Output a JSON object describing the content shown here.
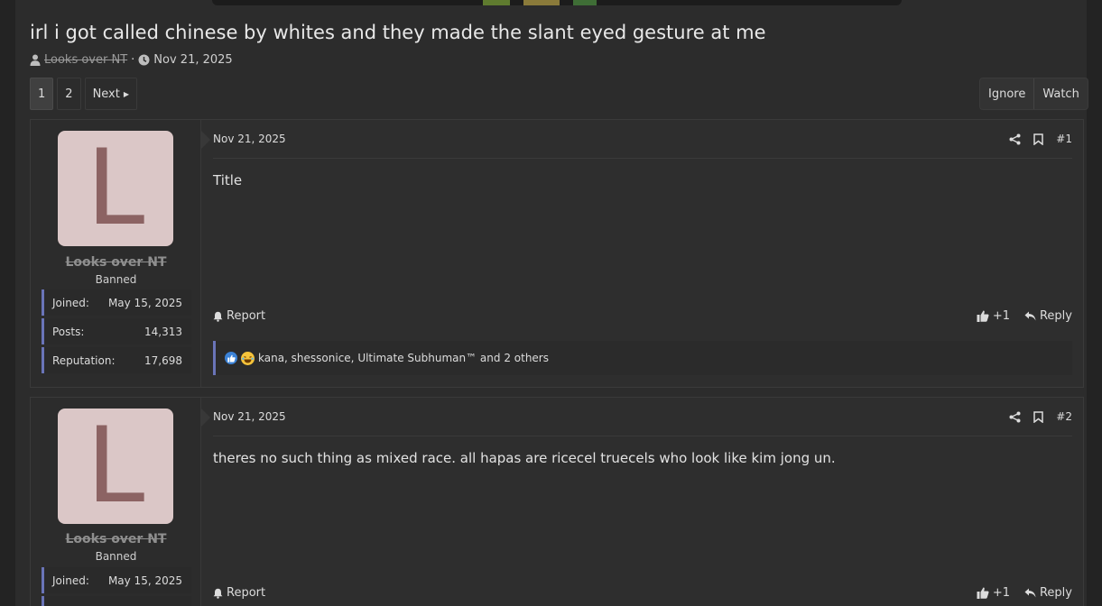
{
  "thread": {
    "title": "irl i got called chinese by whites and they made the slant eyed gesture at me",
    "author": "Looks over NT",
    "separator": "·",
    "date": "Nov 21, 2025"
  },
  "pager": {
    "pages": [
      "1",
      "2"
    ],
    "current": "1",
    "next_label": "Next"
  },
  "actions": {
    "ignore": "Ignore",
    "watch": "Watch"
  },
  "posts": [
    {
      "avatar_letter": "L",
      "username": "Looks over NT",
      "user_title": "Banned",
      "stats": [
        {
          "label": "Joined:",
          "value": "May 15, 2025"
        },
        {
          "label": "Posts:",
          "value": "14,313"
        },
        {
          "label": "Reputation:",
          "value": "17,698"
        }
      ],
      "date": "Nov 21, 2025",
      "number": "#1",
      "body": "Title",
      "report": "Report",
      "plus": "+1",
      "reply": "Reply",
      "reactions": "kana, shessonice, Ultimate Subhuman™ and 2 others"
    },
    {
      "avatar_letter": "L",
      "username": "Looks over NT",
      "user_title": "Banned",
      "stats": [
        {
          "label": "Joined:",
          "value": "May 15, 2025"
        }
      ],
      "date": "Nov 21, 2025",
      "number": "#2",
      "body": "theres no such thing as mixed race. all hapas are ricecel truecels who look like kim jong un.",
      "report": "Report",
      "plus": "+1",
      "reply": "Reply"
    }
  ],
  "colors": {
    "background": "#2c2c2c",
    "accent_border": "#6a74b8",
    "avatar_bg": "#dbc7c7",
    "avatar_fg": "#8c6363"
  },
  "icons": [
    "user-icon",
    "clock-icon",
    "share-icon",
    "bookmark-icon",
    "bell-icon",
    "thumbs-up-icon",
    "reply-icon",
    "like-reaction-icon",
    "haha-reaction-icon"
  ]
}
